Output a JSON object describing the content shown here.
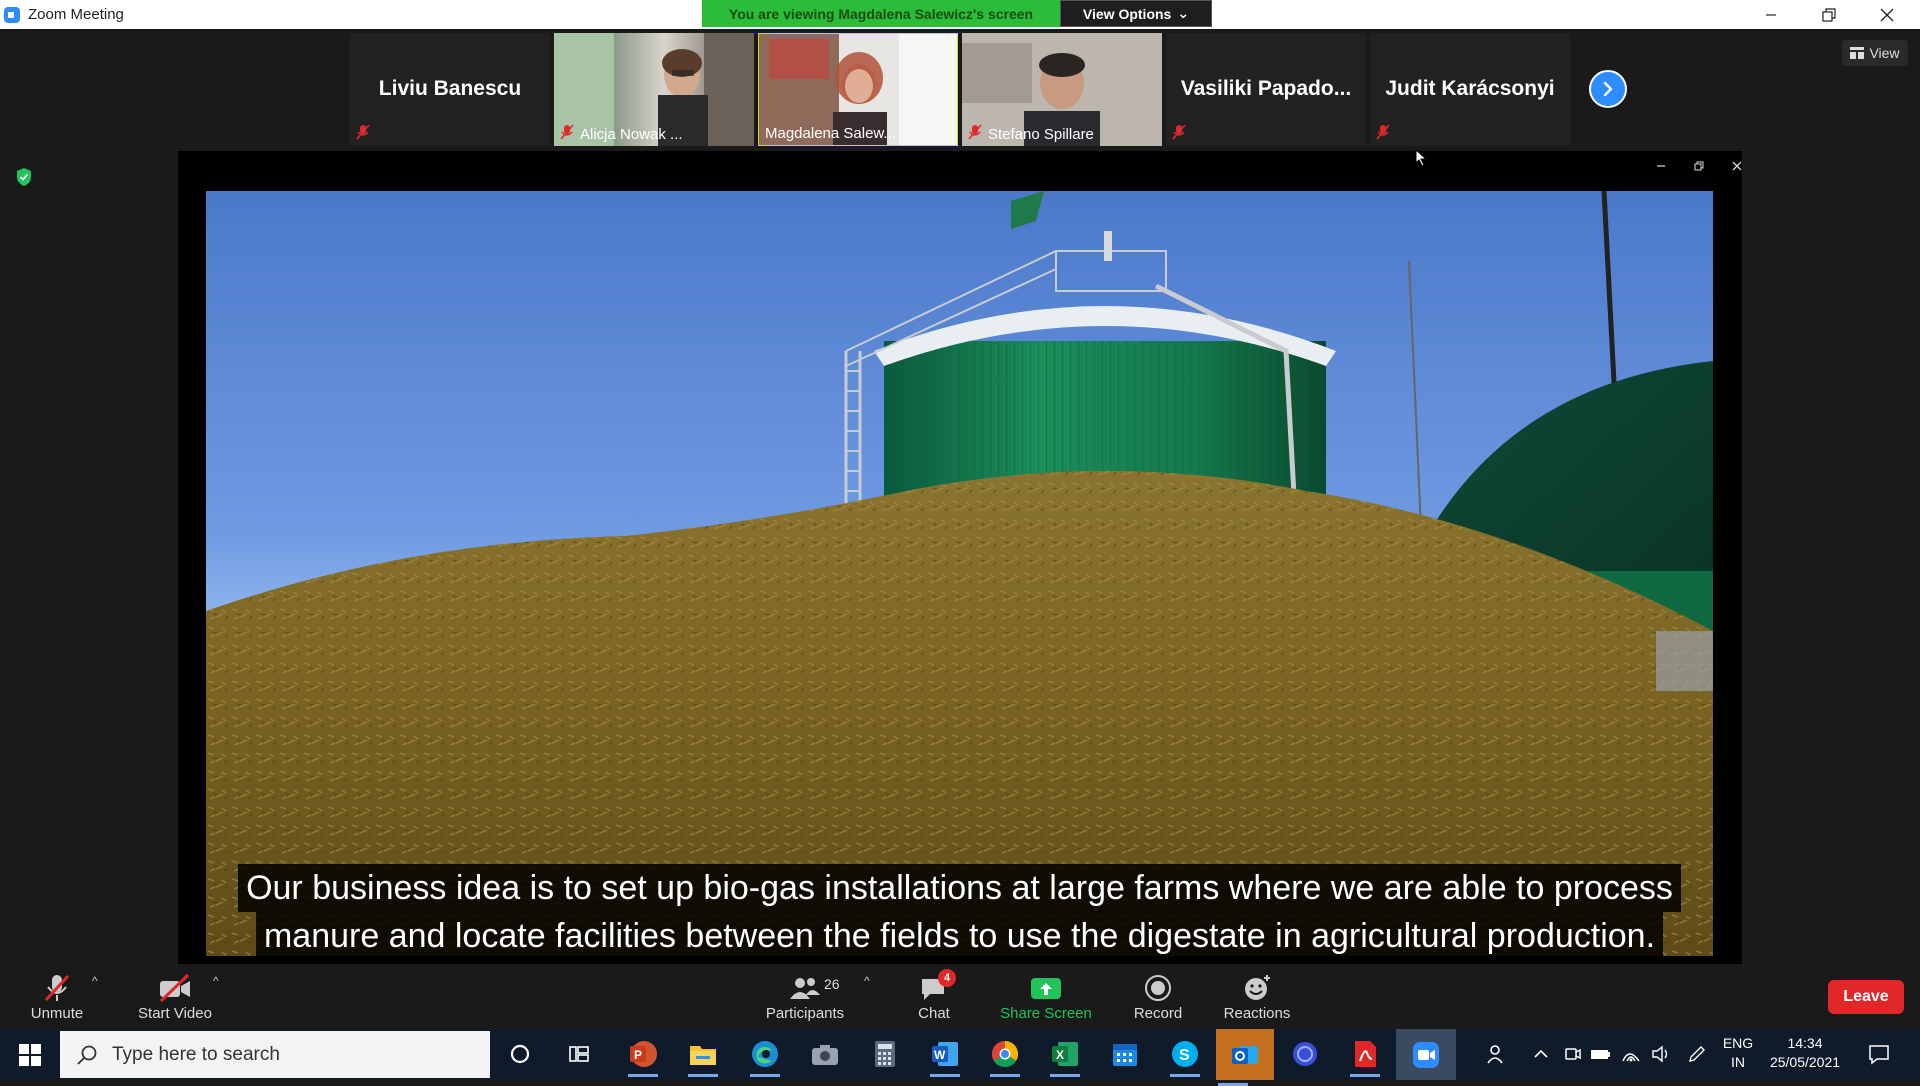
{
  "window": {
    "title": "Zoom Meeting",
    "viewing_banner": "You are viewing Magdalena Salewicz's screen",
    "view_options_label": "View Options"
  },
  "participants_strip": [
    {
      "name": "Liviu Banescu",
      "type": "name",
      "muted": true
    },
    {
      "name": "Alicja Nowak ...",
      "type": "video",
      "muted": true
    },
    {
      "name": "Magdalena Salew...",
      "type": "video",
      "muted": false,
      "active": true
    },
    {
      "name": "Stefano Spillare",
      "type": "video",
      "muted": true
    },
    {
      "name": "Vasiliki  Papado...",
      "type": "name",
      "muted": true
    },
    {
      "name": "Judit Karácsonyi",
      "type": "name",
      "muted": true
    }
  ],
  "view_button_label": "View",
  "shared_screen": {
    "subtitle_lines": [
      "Our business idea is to set up bio-gas installations at large farms where we are able to process",
      "manure and locate facilities between the fields to use the digestate in agricultural production."
    ]
  },
  "toolbar": {
    "unmute_label": "Unmute",
    "start_video_label": "Start Video",
    "participants_label": "Participants",
    "participants_count": "26",
    "chat_label": "Chat",
    "chat_badge": "4",
    "share_screen_label": "Share Screen",
    "record_label": "Record",
    "reactions_label": "Reactions",
    "leave_label": "Leave"
  },
  "taskbar": {
    "search_placeholder": "Type here to search",
    "language_line1": "ENG",
    "language_line2": "IN",
    "time": "14:34",
    "date": "25/05/2021"
  },
  "colors": {
    "zoom_blue": "#2d8cff",
    "banner_green": "#2bbd3a",
    "leave_red": "#e02828",
    "share_green": "#21c35a"
  }
}
